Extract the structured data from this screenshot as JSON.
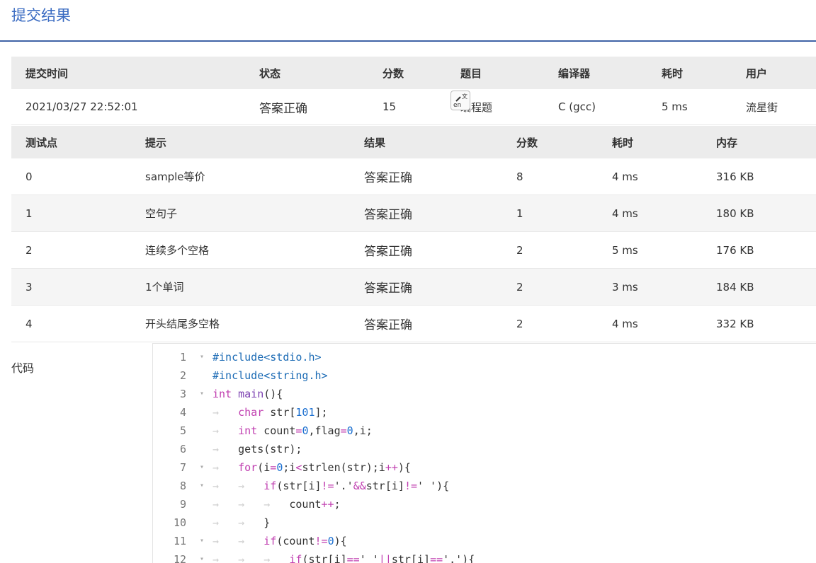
{
  "page": {
    "title": "提交结果"
  },
  "summary": {
    "headers": [
      "提交时间",
      "状态",
      "分数",
      "题目",
      "编译器",
      "耗时",
      "用户"
    ],
    "row": [
      "2021/03/27 22:52:01",
      "答案正确",
      "15",
      "编程题",
      "C (gcc)",
      "5 ms",
      "流星街"
    ]
  },
  "cases": {
    "headers": [
      "测试点",
      "提示",
      "结果",
      "分数",
      "耗时",
      "内存"
    ],
    "rows": [
      [
        "0",
        "sample等价",
        "答案正确",
        "8",
        "4 ms",
        "316 KB"
      ],
      [
        "1",
        "空句子",
        "答案正确",
        "1",
        "4 ms",
        "180 KB"
      ],
      [
        "2",
        "连续多个空格",
        "答案正确",
        "2",
        "5 ms",
        "176 KB"
      ],
      [
        "3",
        "1个单词",
        "答案正确",
        "2",
        "3 ms",
        "184 KB"
      ],
      [
        "4",
        "开头结尾多空格",
        "答案正确",
        "2",
        "4 ms",
        "332 KB"
      ]
    ]
  },
  "code": {
    "label": "代码",
    "line_numbers": [
      "1",
      "2",
      "3",
      "4",
      "5",
      "6",
      "7",
      "8",
      "9",
      "10",
      "11",
      "12"
    ],
    "lines": [
      "#include<stdio.h>",
      "#include<string.h>",
      "int main(){",
      "    char str[101];",
      "    int count=0,flag=0,i;",
      "    gets(str);",
      "    for(i=0;i<strlen(str);i++){",
      "        if(str[i]!='.'&&str[i]!=' '){",
      "            count++;",
      "        }",
      "        if(count!=0){",
      "            if(str[i]==' '||str[i]=='.'){"
    ]
  },
  "colors": {
    "accent": "#3a6bc2",
    "ok": "#e8473f",
    "rule": "#3f63a6"
  }
}
